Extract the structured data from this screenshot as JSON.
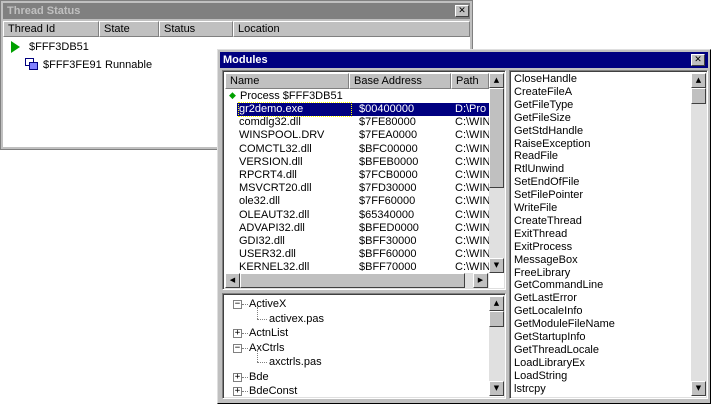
{
  "thread_window": {
    "title": "Thread Status",
    "close_glyph": "✕",
    "columns": [
      "Thread Id",
      "State",
      "Status",
      "Location"
    ],
    "rows": [
      {
        "id": "$FFF3DB51",
        "state": "",
        "icon": "current-thread-arrow-icon"
      },
      {
        "id": "$FFF3FE91",
        "state": "Runnable",
        "icon": "thread-icon"
      }
    ]
  },
  "modules_window": {
    "title": "Modules",
    "close_glyph": "✕",
    "columns": [
      "Name",
      "Base Address",
      "Path"
    ],
    "process_label": "Process $FFF3DB51",
    "modules": [
      {
        "name": "gr2demo.exe",
        "address": "$00400000",
        "path": "D:\\Pro",
        "selected": true
      },
      {
        "name": "comdlg32.dll",
        "address": "$7FE80000",
        "path": "C:\\WIN"
      },
      {
        "name": "WINSPOOL.DRV",
        "address": "$7FEA0000",
        "path": "C:\\WIN"
      },
      {
        "name": "COMCTL32.dll",
        "address": "$BFC00000",
        "path": "C:\\WIN"
      },
      {
        "name": "VERSION.dll",
        "address": "$BFEB0000",
        "path": "C:\\WIN"
      },
      {
        "name": "RPCRT4.dll",
        "address": "$7FCB0000",
        "path": "C:\\WIN"
      },
      {
        "name": "MSVCRT20.dll",
        "address": "$7FD30000",
        "path": "C:\\WIN"
      },
      {
        "name": "ole32.dll",
        "address": "$7FF60000",
        "path": "C:\\WIN"
      },
      {
        "name": "OLEAUT32.dll",
        "address": "$65340000",
        "path": "C:\\WIN"
      },
      {
        "name": "ADVAPI32.dll",
        "address": "$BFED0000",
        "path": "C:\\WIN"
      },
      {
        "name": "GDI32.dll",
        "address": "$BFF30000",
        "path": "C:\\WIN"
      },
      {
        "name": "USER32.dll",
        "address": "$BFF60000",
        "path": "C:\\WIN"
      },
      {
        "name": "KERNEL32.dll",
        "address": "$BFF70000",
        "path": "C:\\WIN"
      }
    ],
    "units": [
      {
        "label": "ActiveX",
        "expander": "−",
        "level": 0
      },
      {
        "label": "activex.pas",
        "expander": "",
        "level": 1
      },
      {
        "label": "ActnList",
        "expander": "+",
        "level": 0
      },
      {
        "label": "AxCtrls",
        "expander": "−",
        "level": 0
      },
      {
        "label": "axctrls.pas",
        "expander": "",
        "level": 1
      },
      {
        "label": "Bde",
        "expander": "+",
        "level": 0
      },
      {
        "label": "BdeConst",
        "expander": "+",
        "level": 0
      }
    ],
    "entry_points": [
      "CloseHandle",
      "CreateFileA",
      "GetFileType",
      "GetFileSize",
      "GetStdHandle",
      "RaiseException",
      "ReadFile",
      "RtlUnwind",
      "SetEndOfFile",
      "SetFilePointer",
      "WriteFile",
      "CreateThread",
      "ExitThread",
      "ExitProcess",
      "MessageBox",
      "FreeLibrary",
      "GetCommandLine",
      "GetLastError",
      "GetLocaleInfo",
      "GetModuleFileName",
      "GetStartupInfo",
      "GetThreadLocale",
      "LoadLibraryEx",
      "LoadString",
      "lstrcpy"
    ]
  },
  "colors": {
    "active_title": "#000080",
    "inactive_title": "#808080",
    "face": "#c0c0c0",
    "arrow_green": "#00a000"
  }
}
